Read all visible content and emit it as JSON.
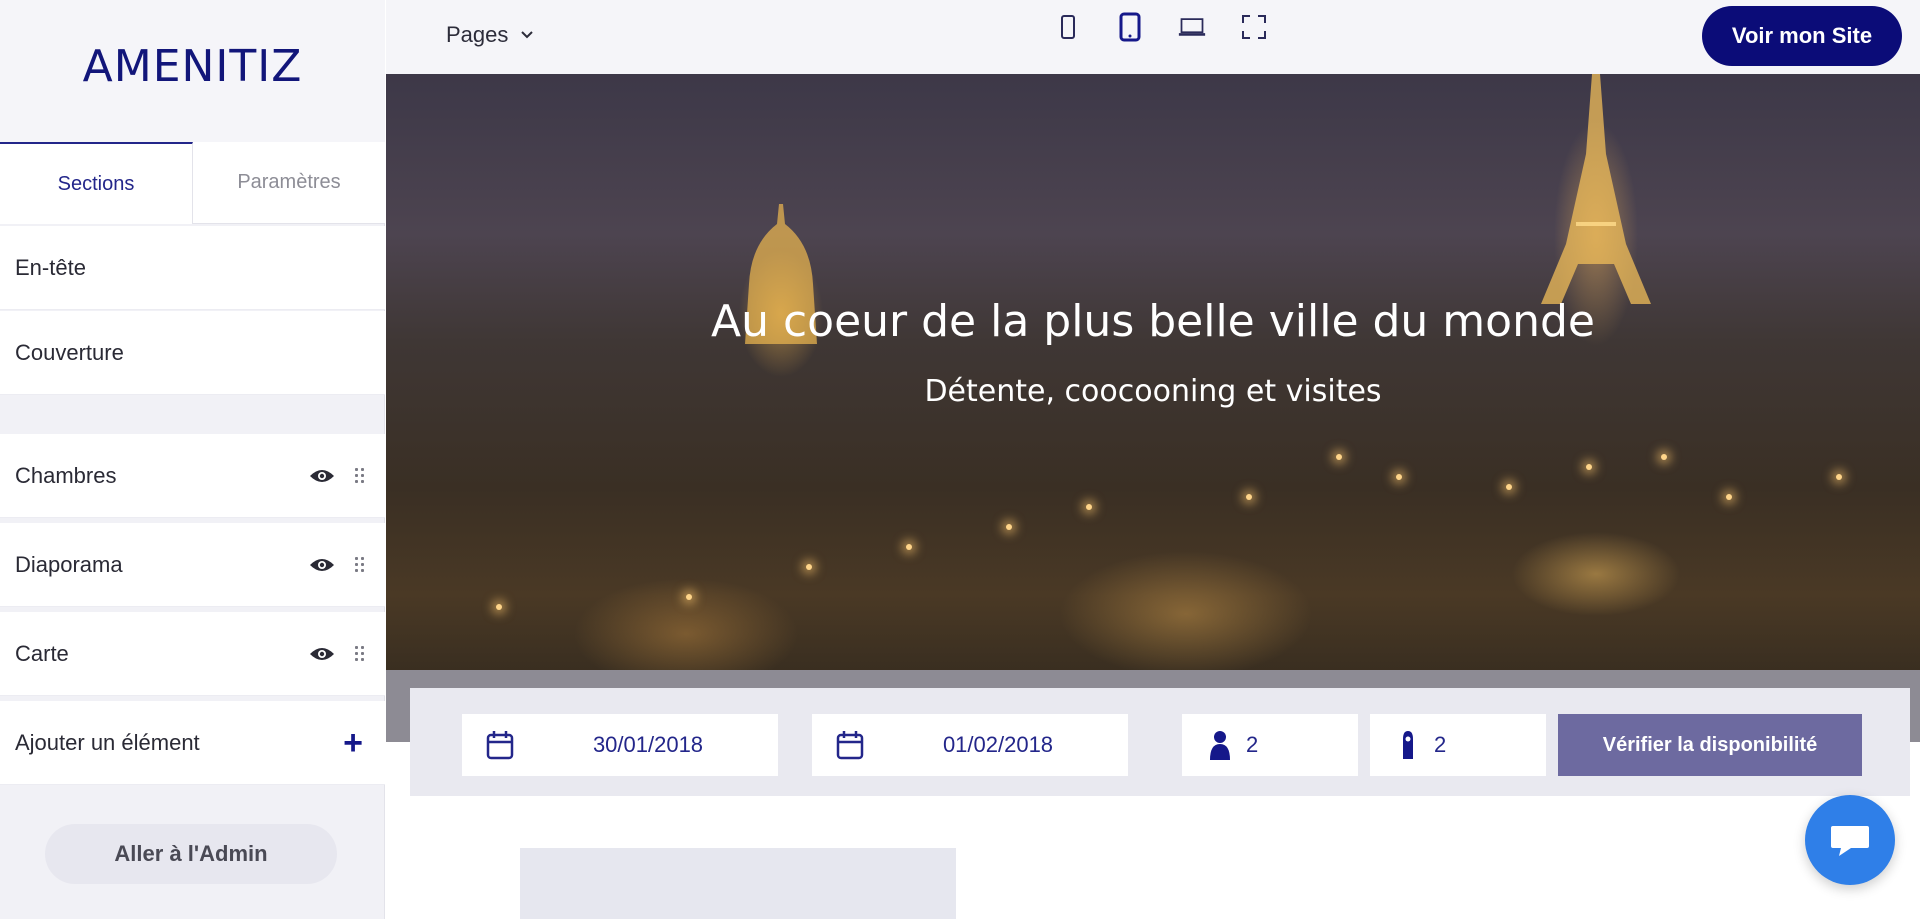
{
  "sidebar": {
    "logo": "AMENITIZ",
    "tabs": [
      "Sections",
      "Paramètres"
    ],
    "fixed_items": [
      "En-tête",
      "Couverture"
    ],
    "items": [
      {
        "label": "Chambres"
      },
      {
        "label": "Diaporama"
      },
      {
        "label": "Carte"
      }
    ],
    "add_label": "Ajouter un élément",
    "admin_button": "Aller à l'Admin"
  },
  "topbar": {
    "pages_label": "Pages",
    "devices": [
      "mobile-icon",
      "tablet-icon",
      "laptop-icon",
      "fullscreen-icon"
    ],
    "site_button": "Voir mon Site"
  },
  "hero": {
    "title": "Au coeur de la plus belle ville du monde",
    "subtitle": "Détente, coocooning et visites"
  },
  "booking": {
    "checkin": "30/01/2018",
    "checkout": "01/02/2018",
    "guests": "2",
    "rooms": "2",
    "verify_button": "Vérifier la disponibilité"
  },
  "colors": {
    "brand": "#12167a",
    "primary_button": "#0b0c78",
    "verify_button": "#6d6aa0",
    "chat": "#2f7fe8"
  }
}
